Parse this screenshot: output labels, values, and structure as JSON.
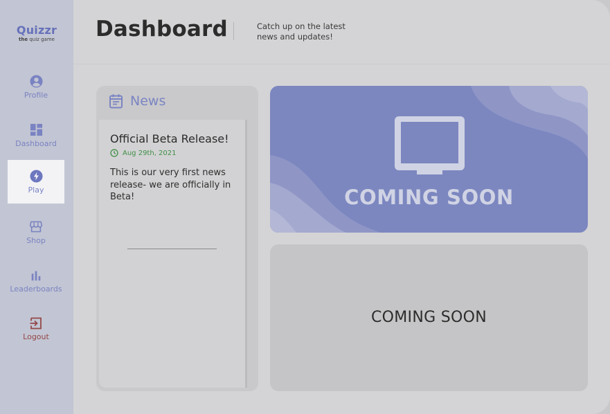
{
  "brand": {
    "name": "Quizzr",
    "tagline_prefix": "the",
    "tagline_rest": "quiz game"
  },
  "sidebar": {
    "items": [
      {
        "label": "Profile",
        "icon": "user-circle-icon"
      },
      {
        "label": "Dashboard",
        "icon": "grid-icon"
      },
      {
        "label": "Play",
        "icon": "lightning-icon",
        "active": true
      },
      {
        "label": "Shop",
        "icon": "store-icon"
      },
      {
        "label": "Leaderboards",
        "icon": "bar-chart-icon"
      },
      {
        "label": "Logout",
        "icon": "logout-icon"
      }
    ]
  },
  "header": {
    "title": "Dashboard",
    "subtitle": "Catch up on the latest news and updates!"
  },
  "news": {
    "heading": "News",
    "items": [
      {
        "title": "Official Beta Release!",
        "date": "Aug 29th, 2021",
        "body": "This is our very first news release- we are officially in Beta!"
      }
    ]
  },
  "banner": {
    "text": "COMING SOON"
  },
  "secondary_card": {
    "text": "COMING SOON"
  },
  "colors": {
    "accent": "#7c87c0",
    "logout": "#944848",
    "date_green": "#3f8f46",
    "brand": "#6671ba"
  }
}
